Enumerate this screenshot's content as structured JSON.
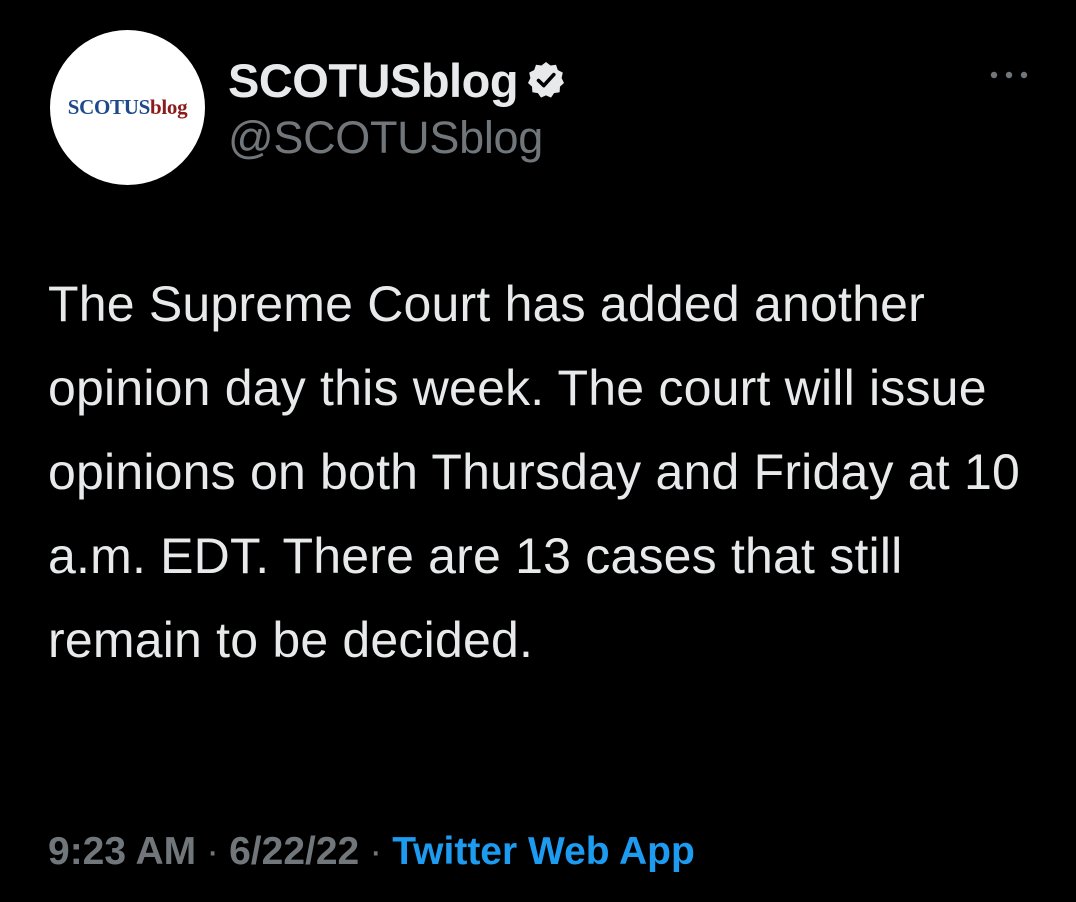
{
  "author": {
    "display_name": "SCOTUSblog",
    "handle": "@SCOTUSblog",
    "verified": true,
    "avatar_logo_part1": "SCOTUS",
    "avatar_logo_part2": "blog"
  },
  "tweet": {
    "text": "The Supreme Court has added another opinion day this week. The court will issue opinions on both Thursday and Friday at 10 a.m. EDT. There are 13 cases that still remain to be decided.",
    "time": "9:23 AM",
    "separator": "·",
    "date": "6/22/22",
    "source": "Twitter Web App"
  },
  "icons": {
    "more": "more-horizontal-icon",
    "verified": "verified-badge-icon"
  },
  "colors": {
    "background": "#000000",
    "text": "#e7e9ea",
    "muted": "#71767b",
    "link": "#1d9bf0",
    "logo_blue": "#1e4a8c",
    "logo_red": "#8b1a1a"
  }
}
